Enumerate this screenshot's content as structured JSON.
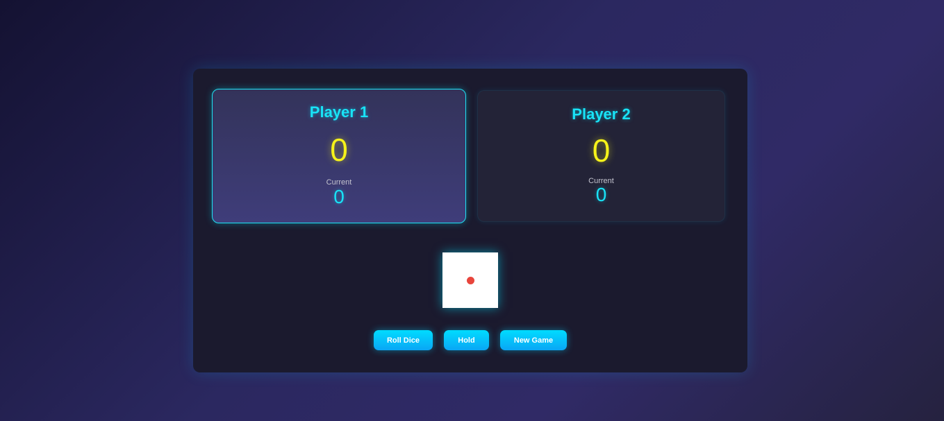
{
  "players": [
    {
      "name": "Player 1",
      "total_score": "0",
      "current_label": "Current",
      "current_score": "0",
      "active": true
    },
    {
      "name": "Player 2",
      "total_score": "0",
      "current_label": "Current",
      "current_score": "0",
      "active": false
    }
  ],
  "dice": {
    "value": 1,
    "face_color": "#ffffff",
    "pip_color": "#e8453c"
  },
  "controls": {
    "roll_label": "Roll Dice",
    "hold_label": "Hold",
    "new_game_label": "New Game"
  },
  "colors": {
    "accent_cyan": "#19e3f6",
    "score_yellow": "#f5f21a",
    "card_background": "#1b1a2e"
  }
}
